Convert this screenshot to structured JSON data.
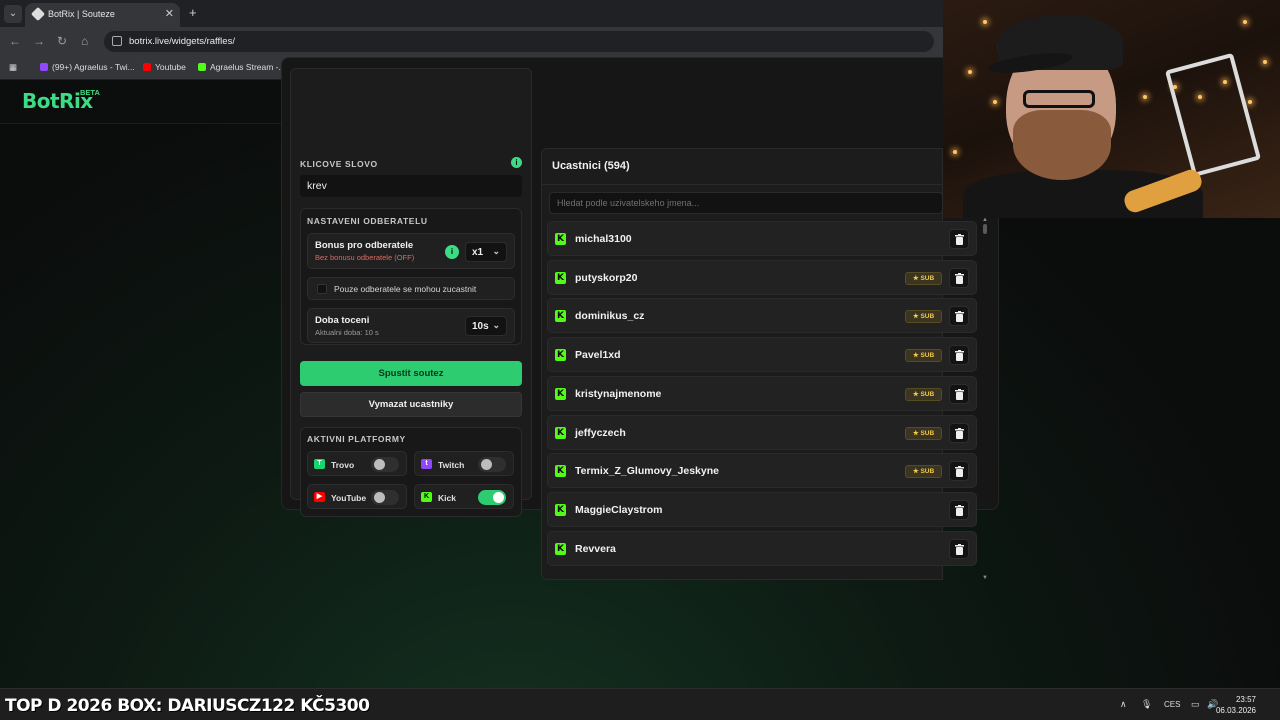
{
  "browser": {
    "tab_title": "BotRix | Souteze",
    "tab_close": "✕",
    "new_tab": "+",
    "url": "botrix.live/widgets/raffles/",
    "bookmarks": [
      {
        "label": "(99+) Agraelus - Twi...",
        "color": "#9146ff"
      },
      {
        "label": "Youtube",
        "color": "#ff0000"
      },
      {
        "label": "Agraelus Stream -...",
        "color": "#53fc18"
      }
    ]
  },
  "app": {
    "logo": "BotRix",
    "beta": "BETA"
  },
  "keyword": {
    "label": "KLICOVE SLOVO",
    "value": "krev",
    "info_icon": "i"
  },
  "subscribers": {
    "label": "NASTAVENI ODBERATELU",
    "bonus_title": "Bonus pro odberatele",
    "bonus_sub": "Bez bonusu odberatele (OFF)",
    "bonus_value": "x1",
    "only_subs_label": "Pouze odberatele se mohou zucastnit",
    "spin_title": "Doba toceni",
    "spin_sub": "Aktualni doba: 10 s",
    "spin_value": "10s"
  },
  "buttons": {
    "start": "Spustit soutez",
    "clear": "Vymazat ucastniky"
  },
  "platforms": {
    "label": "AKTIVNI PLATFORMY",
    "items": [
      {
        "name": "Trovo",
        "enabled": false,
        "icon": "trovo-icon",
        "color": "#19d66b"
      },
      {
        "name": "Twitch",
        "enabled": false,
        "icon": "twitch-icon",
        "color": "#9146ff"
      },
      {
        "name": "YouTube",
        "enabled": false,
        "icon": "youtube-icon",
        "color": "#ff0000"
      },
      {
        "name": "Kick",
        "enabled": true,
        "icon": "kick-icon",
        "color": "#53fc18"
      }
    ]
  },
  "participants": {
    "title": "Ucastnici (594)",
    "search_placeholder": "Hledat podle uzivatelskeho jmena...",
    "sub_badge": "★ SUB",
    "list": [
      {
        "name": "michal3100",
        "sub": false
      },
      {
        "name": "putyskorp20",
        "sub": true
      },
      {
        "name": "dominikus_cz",
        "sub": true
      },
      {
        "name": "Pavel1xd",
        "sub": true
      },
      {
        "name": "kristynajmenome",
        "sub": true
      },
      {
        "name": "jeffyczech",
        "sub": true
      },
      {
        "name": "Termix_Z_Glumovy_Jeskyne",
        "sub": true
      },
      {
        "name": "MaggieClaystrom",
        "sub": false
      },
      {
        "name": "Revvera",
        "sub": false
      }
    ]
  },
  "taskbar": {
    "ticker": "TOP D 2026 BOX: DARIUSCZ122 KČ5300",
    "lang": "CES",
    "time": "23:57",
    "date": "06.03.2026"
  },
  "colors": {
    "accent": "#2ecc71",
    "kick": "#53fc18",
    "sub_gold": "#f2c94c"
  }
}
